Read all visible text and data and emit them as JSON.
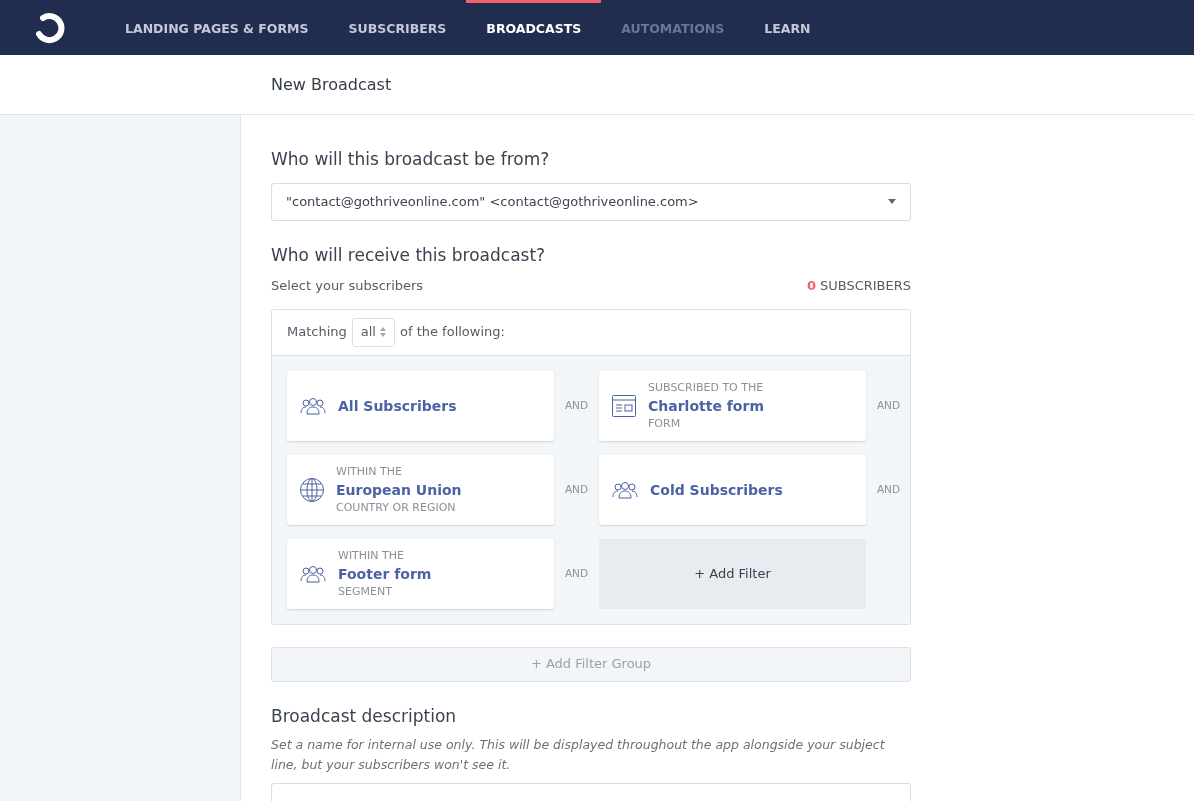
{
  "nav": {
    "items": [
      {
        "label": "LANDING PAGES & FORMS",
        "selected": false,
        "disabled": false
      },
      {
        "label": "SUBSCRIBERS",
        "selected": false,
        "disabled": false
      },
      {
        "label": "BROADCASTS",
        "selected": true,
        "disabled": false
      },
      {
        "label": "AUTOMATIONS",
        "selected": false,
        "disabled": true
      },
      {
        "label": "LEARN",
        "selected": false,
        "disabled": false
      }
    ]
  },
  "page_title": "New Broadcast",
  "from": {
    "heading": "Who will this broadcast be from?",
    "value": "\"contact@gothriveonline.com\" <contact@gothriveonline.com>"
  },
  "recipients": {
    "heading": "Who will receive this broadcast?",
    "hint": "Select your subscribers",
    "count": "0",
    "count_label": "SUBSCRIBERS",
    "matching": {
      "before": "Matching",
      "value": "all",
      "after": "of the following:"
    },
    "filters": [
      {
        "kind": "segment",
        "name": "All Subscribers",
        "connector": "AND"
      },
      {
        "kind": "form",
        "prefix": "SUBSCRIBED TO THE",
        "name": "Charlotte form",
        "suffix": "FORM",
        "connector": "AND"
      },
      {
        "kind": "location",
        "prefix": "WITHIN THE",
        "name": "European Union",
        "suffix": "COUNTRY OR REGION",
        "connector": "AND"
      },
      {
        "kind": "segment",
        "name": "Cold Subscribers",
        "connector": "AND"
      },
      {
        "kind": "segment",
        "prefix": "WITHIN THE",
        "name": "Footer form",
        "suffix": "SEGMENT",
        "connector": "AND"
      },
      {
        "kind": "add",
        "name": "+ Add Filter"
      }
    ],
    "add_group": "+ Add Filter Group"
  },
  "description": {
    "heading": "Broadcast description",
    "hint": "Set a name for internal use only. This will be displayed throughout the app alongside your subject line, but your subscribers won't see it."
  }
}
